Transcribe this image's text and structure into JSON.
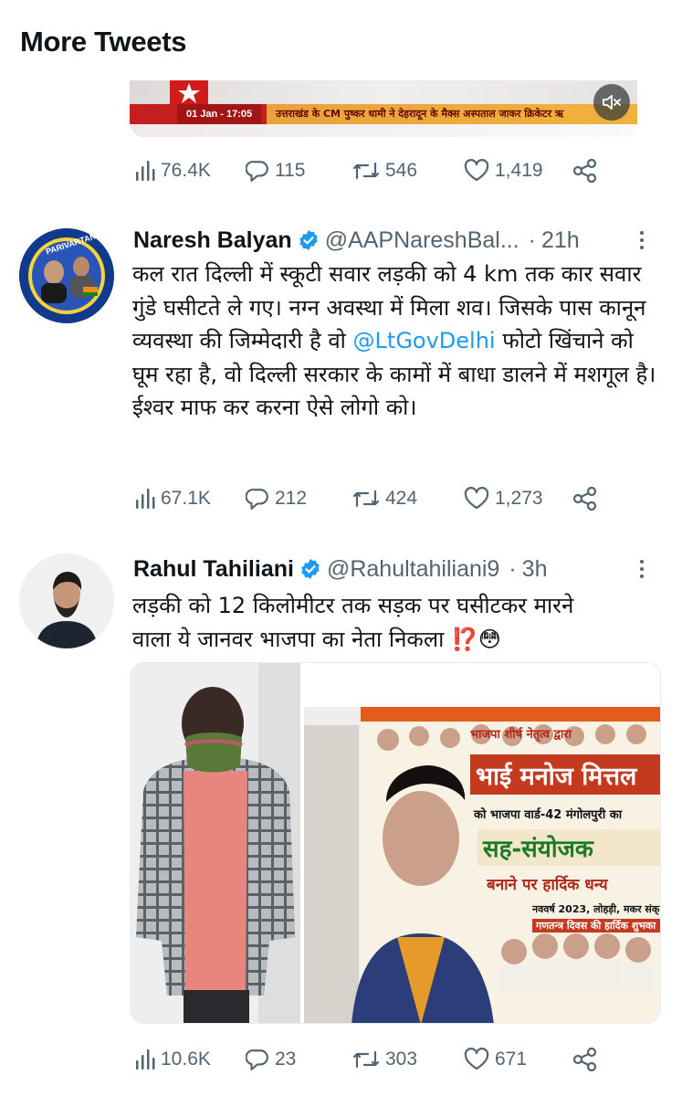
{
  "header": {
    "title": "More Tweets"
  },
  "top_video": {
    "date_chip": "01 Jan - 17:05",
    "ticker": "उत्तराखंड के CM पुष्कर धामी ने देहरादून के मैक्स अस्पताल जाकर क्रिकेटर ऋ",
    "mute_icon": "speaker-muted-icon"
  },
  "tweet0": {
    "views": "76.4K",
    "replies": "115",
    "retweets": "546",
    "likes": "1,419"
  },
  "tweet1": {
    "name": "Naresh Balyan",
    "handle": "@AAPNareshBal...",
    "time": "21h",
    "avatar_caption": "PARIVARTAN",
    "text_before": "कल रात दिल्ली में स्कूटी सवार लड़की को 4 km तक कार सवार गुंडे घसीटते ले गए। नग्न अवस्था में मिला शव। जिसके पास कानून व्यवस्था की जिम्मेदारी है वो ",
    "mention": "@LtGovDelhi",
    "text_after": " फोटो खिंचाने को घूम रहा है, वो दिल्ली सरकार के कामों में बाधा डालने में मशगूल है। ईश्वर माफ कर करना ऐसे लोगो को।",
    "views": "67.1K",
    "replies": "212",
    "retweets": "424",
    "likes": "1,273"
  },
  "tweet2": {
    "name": "Rahul Tahiliani",
    "handle": "@Rahultahiliani9",
    "time": "3h",
    "text": "लड़की को 12 किलोमीटर तक सड़क पर घसीटकर मारने वाला ये जानवर भाजपा का नेता निकला ⁉️😳",
    "poster": {
      "line1": "भाजपा शीर्ष नेतृत्व द्वारा",
      "line2": "भाई मनोज मित्तल",
      "line3": "को भाजपा वार्ड-42 मंगोलपुरी का",
      "line4": "सह-संयोजक",
      "line5": "बनाने पर हार्दिक धन्य",
      "line6": "नववर्ष 2023, लोहड़ी, मकर संक्",
      "line7": "गणतन्त्र दिवस की हार्दिक शुभका"
    },
    "views": "10.6K",
    "replies": "23",
    "retweets": "303",
    "likes": "671"
  },
  "colors": {
    "secondary": "#536471",
    "link": "#1d9bf0",
    "verified": "#1d9bf0"
  }
}
